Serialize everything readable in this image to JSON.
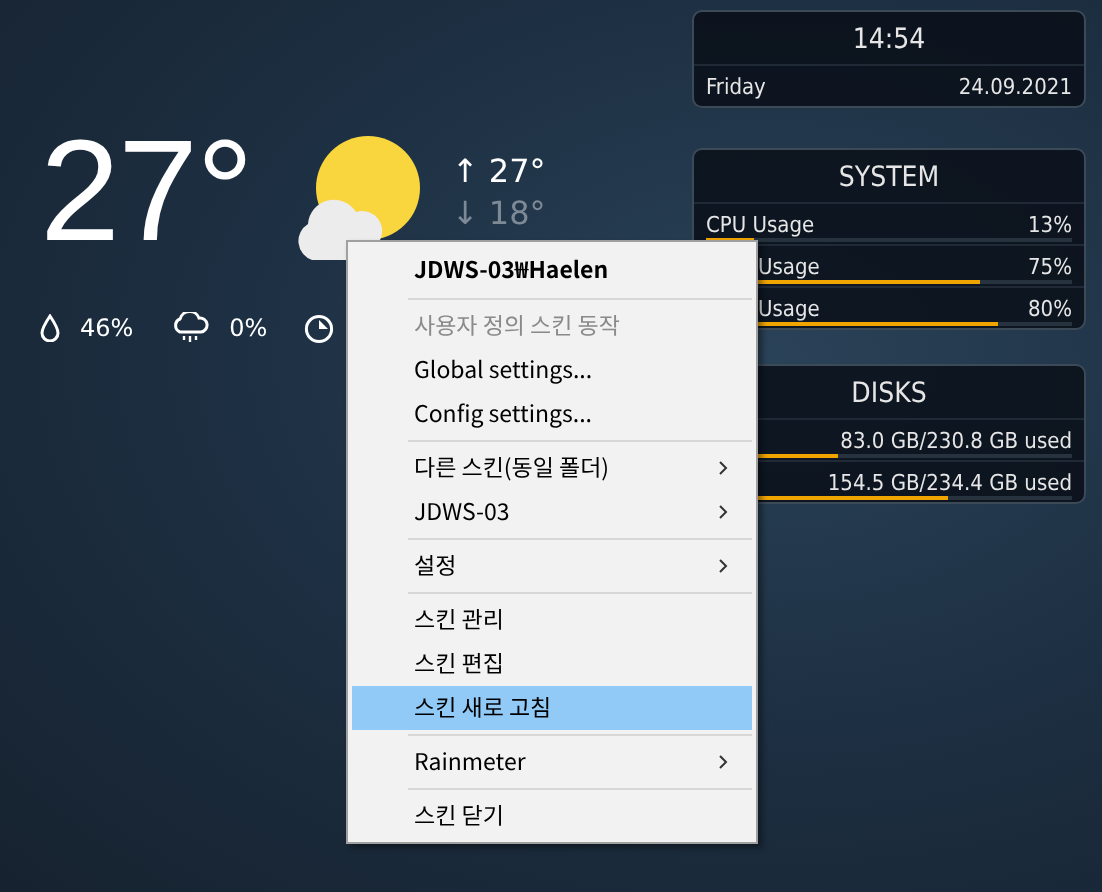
{
  "weather": {
    "temperature": "27°",
    "high": "↑ 27°",
    "low": "↓ 18°",
    "stats": [
      {
        "kind": "humidity",
        "value": "46%"
      },
      {
        "kind": "rain",
        "value": "0%"
      },
      {
        "kind": "wind"
      }
    ]
  },
  "clock": {
    "time": "14:54",
    "day": "Friday",
    "date": "24.09.2021"
  },
  "system": {
    "title": "SYSTEM",
    "rows": [
      {
        "label": "CPU Usage",
        "value": "13%",
        "level": 0.13,
        "kind": "full"
      },
      {
        "label": "Usage",
        "value": "75%",
        "level": 0.75,
        "kind": "partial"
      },
      {
        "label": "Usage",
        "value": "80%",
        "level": 0.8,
        "kind": "partial"
      }
    ]
  },
  "disks": {
    "title": "DISKS",
    "rows": [
      {
        "value": "83.0 GB/230.8 GB used",
        "level": 0.36
      },
      {
        "value": "154.5 GB/234.4 GB used",
        "level": 0.66
      }
    ]
  },
  "context_menu": {
    "items": [
      {
        "kind": "header",
        "label": "JDWS-03₩Haelen"
      },
      {
        "kind": "separator"
      },
      {
        "kind": "item",
        "label": "사용자 정의 스킨 동작",
        "disabled": true,
        "submenu": false,
        "selected": false
      },
      {
        "kind": "item",
        "label": "Global settings...",
        "disabled": false,
        "submenu": false,
        "selected": false
      },
      {
        "kind": "item",
        "label": "Config settings...",
        "disabled": false,
        "submenu": false,
        "selected": false
      },
      {
        "kind": "separator"
      },
      {
        "kind": "item",
        "label": "다른 스킨(동일 폴더)",
        "disabled": false,
        "submenu": true,
        "selected": false
      },
      {
        "kind": "item",
        "label": "JDWS-03",
        "disabled": false,
        "submenu": true,
        "selected": false
      },
      {
        "kind": "separator"
      },
      {
        "kind": "item",
        "label": "설정",
        "disabled": false,
        "submenu": true,
        "selected": false
      },
      {
        "kind": "separator"
      },
      {
        "kind": "item",
        "label": "스킨 관리",
        "disabled": false,
        "submenu": false,
        "selected": false
      },
      {
        "kind": "item",
        "label": "스킨 편집",
        "disabled": false,
        "submenu": false,
        "selected": false
      },
      {
        "kind": "item",
        "label": "스킨 새로 고침",
        "disabled": false,
        "submenu": false,
        "selected": true
      },
      {
        "kind": "separator"
      },
      {
        "kind": "item",
        "label": "Rainmeter",
        "disabled": false,
        "submenu": true,
        "selected": false
      },
      {
        "kind": "separator"
      },
      {
        "kind": "item",
        "label": "스킨 닫기",
        "disabled": false,
        "submenu": false,
        "selected": false
      }
    ]
  }
}
